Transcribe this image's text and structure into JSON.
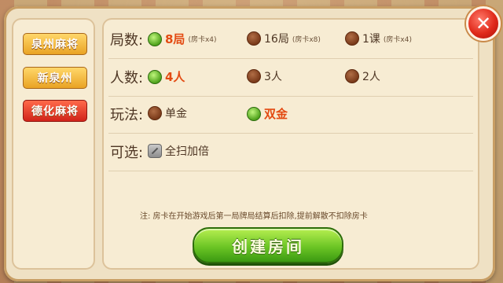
{
  "sidebar": {
    "items": [
      {
        "label": "泉州麻将",
        "color": "#f2b63a"
      },
      {
        "label": "新泉州",
        "color": "#f2b63a"
      },
      {
        "label": "德化麻将",
        "color": "#e73b22"
      }
    ]
  },
  "rules": {
    "rounds": {
      "label": "局数:",
      "options": [
        {
          "main": "8局",
          "sub": "(房卡x4)",
          "selected": true
        },
        {
          "main": "16局",
          "sub": "(房卡x8)",
          "selected": false
        },
        {
          "main": "1课",
          "sub": "(房卡x4)",
          "selected": false
        }
      ]
    },
    "players": {
      "label": "人数:",
      "options": [
        {
          "main": "4人",
          "selected": true
        },
        {
          "main": "3人",
          "selected": false
        },
        {
          "main": "2人",
          "selected": false
        }
      ]
    },
    "play_style": {
      "label": "玩法:",
      "options": [
        {
          "main": "单金",
          "selected": false
        },
        {
          "main": "双金",
          "selected": true
        }
      ]
    },
    "optional": {
      "label": "可选:",
      "options": [
        {
          "main": "全扫加倍",
          "checked": false
        }
      ]
    }
  },
  "note": "注: 房卡在开始游戏后第一局牌局结算后扣除,提前解散不扣除房卡",
  "create_button": "创建房间",
  "close_icon": "close-icon",
  "colors": {
    "accent_selected": "#e34a12",
    "radio_on": "#5bb624",
    "radio_off": "#8a4a25",
    "create_button": "#5db21f",
    "close_button": "#e02a1b"
  }
}
